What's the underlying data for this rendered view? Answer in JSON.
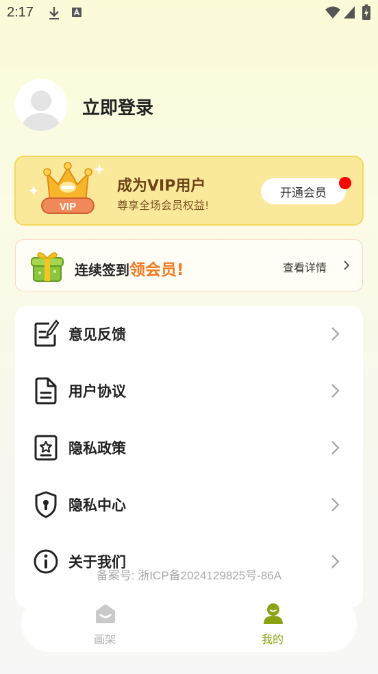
{
  "status_bar": {
    "time": "2:17"
  },
  "profile": {
    "login_label": "立即登录"
  },
  "vip": {
    "title": "成为VIP用户",
    "subtitle": "尊享全场会员权益!",
    "badge_text": "VIP",
    "button_label": "开通会员"
  },
  "signin": {
    "text_prefix": "连续签到",
    "text_highlight": "领会员!",
    "detail_label": "查看详情"
  },
  "menu": {
    "items": [
      {
        "label": "意见反馈",
        "icon": "feedback-icon"
      },
      {
        "label": "用户协议",
        "icon": "document-icon"
      },
      {
        "label": "隐私政策",
        "icon": "privacy-policy-icon"
      },
      {
        "label": "隐私中心",
        "icon": "shield-icon"
      },
      {
        "label": "关于我们",
        "icon": "info-icon"
      }
    ]
  },
  "filing_text": "备案号: 浙ICP备2024129825号-86A",
  "nav": {
    "items": [
      {
        "label": "画架",
        "icon": "shelf-icon",
        "active": false
      },
      {
        "label": "我的",
        "icon": "profile-icon",
        "active": true
      }
    ]
  },
  "colors": {
    "accent_active": "#8aa313",
    "vip_bg": "#fbe99b",
    "highlight_orange": "#f37a1f"
  }
}
